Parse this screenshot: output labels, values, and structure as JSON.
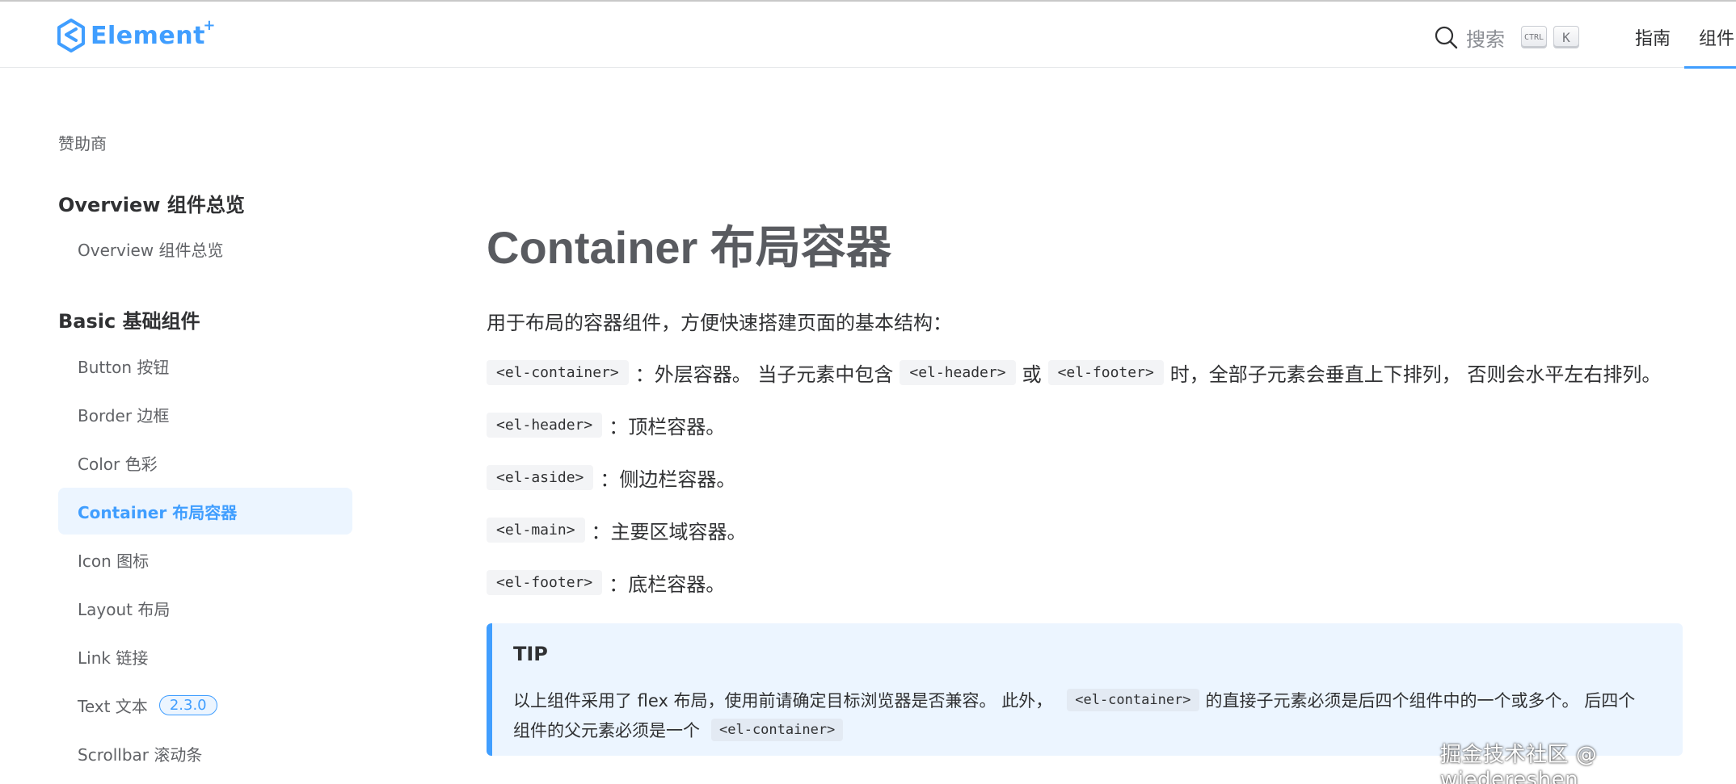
{
  "colors": {
    "brand": "#409eff",
    "active_bg": "#ecf5ff",
    "tip_bg": "#ecf5ff"
  },
  "header": {
    "logo_text": "Element",
    "logo_plus": "+",
    "search_label": "搜索",
    "kbd_ctrl": "CTRL",
    "kbd_k": "K",
    "nav": {
      "guide": "指南",
      "component": "组件"
    }
  },
  "sidebar": {
    "sponsor": "赞助商",
    "group_overview": "Overview 组件总览",
    "item_overview": "Overview 组件总览",
    "group_basic": "Basic 基础组件",
    "items": [
      {
        "label": "Button 按钮"
      },
      {
        "label": "Border 边框"
      },
      {
        "label": "Color 色彩"
      },
      {
        "label": "Container 布局容器"
      },
      {
        "label": "Icon 图标"
      },
      {
        "label": "Layout 布局"
      },
      {
        "label": "Link 链接"
      },
      {
        "label": "Text 文本",
        "badge": "2.3.0"
      },
      {
        "label": "Scrollbar 滚动条"
      }
    ]
  },
  "main": {
    "title": "Container 布局容器",
    "intro": "用于布局的容器组件，方便快速搭建页面的基本结构：",
    "p1": {
      "code1": "<el-container>",
      "t1": "：外层容器。 当子元素中包含",
      "code2": "<el-header>",
      "t2": "或",
      "code3": "<el-footer>",
      "t3": "时，全部子元素会垂直上下排列， 否则会水平左右排列。"
    },
    "p2": {
      "code": "<el-header>",
      "text": "：顶栏容器。"
    },
    "p3": {
      "code": "<el-aside>",
      "text": "：侧边栏容器。"
    },
    "p4": {
      "code": "<el-main>",
      "text": "：主要区域容器。"
    },
    "p5": {
      "code": "<el-footer>",
      "text": "：底栏容器。"
    },
    "tip": {
      "title": "TIP",
      "line1_a": "以上组件采用了 flex 布局，使用前请确定目标浏览器是否兼容。 此外，",
      "line1_code": "<el-container>",
      "line1_b": "的直接子元素必须是后四个组件中的一个或多个。 后四个",
      "line2_a": "组件的父元素必须是一个",
      "line2_code": "<el-container>"
    }
  },
  "watermark": "掘金技术社区 @ wiedereshen"
}
